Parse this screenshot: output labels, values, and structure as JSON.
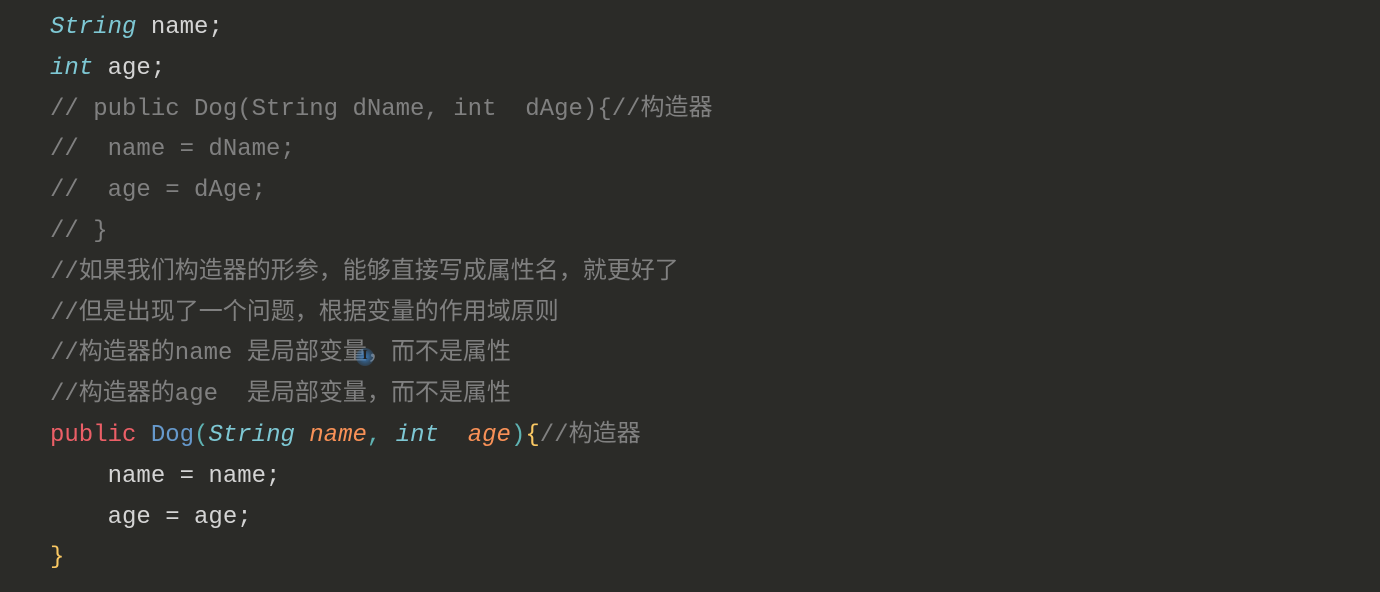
{
  "lines": {
    "l1": {
      "type": "String",
      "ident": " name",
      "semi": ";"
    },
    "l2": {
      "type": "int",
      "ident": " age",
      "semi": ";"
    },
    "l3": {
      "comment": "// public Dog(String dName, int  dAge){//构造器"
    },
    "l4": {
      "comment": "//  name = dName;"
    },
    "l5": {
      "comment": "//  age = dAge;"
    },
    "l6": {
      "comment": "// }"
    },
    "l7": {
      "comment": "//如果我们构造器的形参，能够直接写成属性名，就更好了"
    },
    "l8": {
      "comment": "//但是出现了一个问题，根据变量的作用域原则"
    },
    "l9": {
      "comment": "//构造器的name 是局部变量，而不是属性"
    },
    "l10": {
      "comment": "//构造器的age  是局部变量，而不是属性"
    },
    "l11": {
      "keyword": "public",
      "space1": " ",
      "classname": "Dog",
      "lparen": "(",
      "ptype1": "String",
      "space2": " ",
      "pname1": "name",
      "comma": ", ",
      "ptype2": "int",
      "space3": "  ",
      "pname2": "age",
      "rparen": ")",
      "lbrace": "{",
      "comment": "//构造器"
    },
    "l12": {
      "text": "    name = name;"
    },
    "l13": {
      "text": "    age = age;"
    },
    "l14": {
      "brace": "}"
    }
  },
  "cursor": {
    "glyph": "I"
  }
}
